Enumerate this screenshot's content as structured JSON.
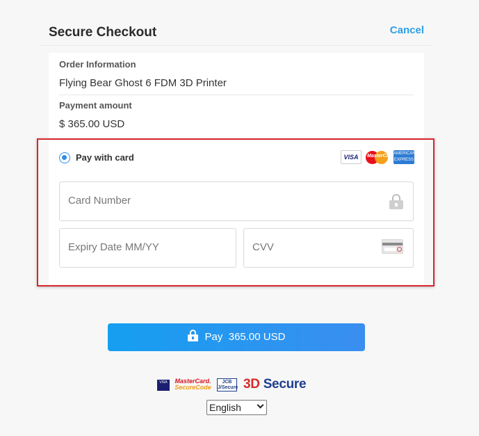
{
  "header": {
    "title": "Secure Checkout",
    "cancel_label": "Cancel"
  },
  "order": {
    "info_label": "Order Information",
    "product": "Flying Bear Ghost 6 FDM 3D Printer",
    "amount_label": "Payment amount",
    "amount": "$ 365.00 USD"
  },
  "payment": {
    "method_label": "Pay with card",
    "method_selected": true,
    "brand_visa": "VISA",
    "brand_mastercard": "MasterCard",
    "brand_amex": "AMERICAN EXPRESS",
    "card_number_placeholder": "Card Number",
    "expiry_placeholder": "Expiry Date MM/YY",
    "cvv_placeholder": "CVV"
  },
  "pay_button": {
    "label": "Pay",
    "amount": "365.00 USD"
  },
  "trust": {
    "visa": "VISA",
    "mastercard_line1": "MasterCard.",
    "mastercard_line2": "SecureCode",
    "jcb_line1": "JCB",
    "jcb_line2": "J/Secure",
    "secure3d_prefix": "3D",
    "secure3d_suffix": "Secure"
  },
  "language": {
    "selected": "English"
  },
  "colors": {
    "accent": "#2f9fe8",
    "highlight_border": "#d9262a",
    "pay_button": "#159ff0"
  }
}
